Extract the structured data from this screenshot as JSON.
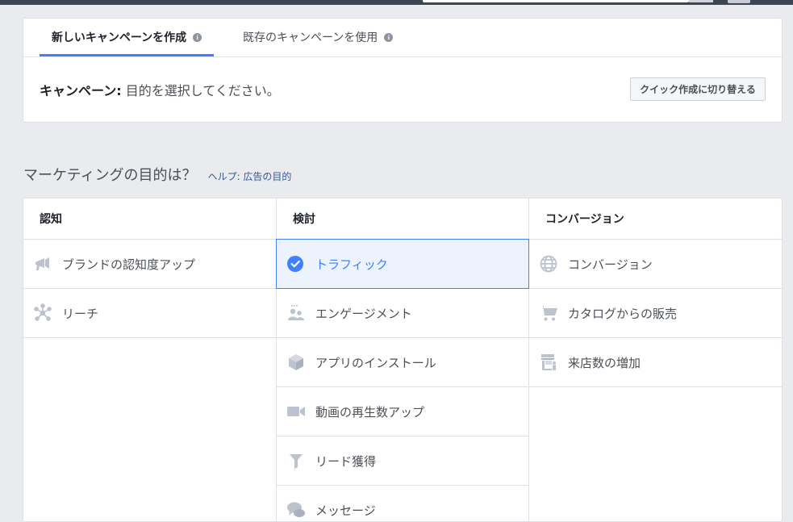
{
  "tabs": [
    {
      "label": "新しいキャンペーンを作成",
      "info": "i"
    },
    {
      "label": "既存のキャンペーンを使用",
      "info": "i"
    }
  ],
  "campaign": {
    "label": "キャンペーン:",
    "text": " 目的を選択してください。"
  },
  "quick_button": "クイック作成に切り替える",
  "heading": {
    "text": "マーケティングの目的は？",
    "help": "ヘルプ: 広告の目的"
  },
  "colors": {
    "accent": "#4080ff",
    "icon": "#bcc3cf",
    "link": "#365899"
  },
  "columns": [
    {
      "header": "認知",
      "items": [
        {
          "label": "ブランドの認知度アップ",
          "icon": "megaphone-icon"
        },
        {
          "label": "リーチ",
          "icon": "reach-icon"
        }
      ]
    },
    {
      "header": "検討",
      "items": [
        {
          "label": "トラフィック",
          "icon": "check-circle-icon",
          "selected": true
        },
        {
          "label": "エンゲージメント",
          "icon": "people-icon"
        },
        {
          "label": "アプリのインストール",
          "icon": "box-icon"
        },
        {
          "label": "動画の再生数アップ",
          "icon": "video-camera-icon"
        },
        {
          "label": "リード獲得",
          "icon": "funnel-icon"
        },
        {
          "label": "メッセージ",
          "icon": "chat-bubbles-icon"
        }
      ]
    },
    {
      "header": "コンバージョン",
      "items": [
        {
          "label": "コンバージョン",
          "icon": "globe-icon"
        },
        {
          "label": "カタログからの販売",
          "icon": "shopping-cart-icon"
        },
        {
          "label": "来店数の増加",
          "icon": "store-icon"
        }
      ]
    }
  ]
}
